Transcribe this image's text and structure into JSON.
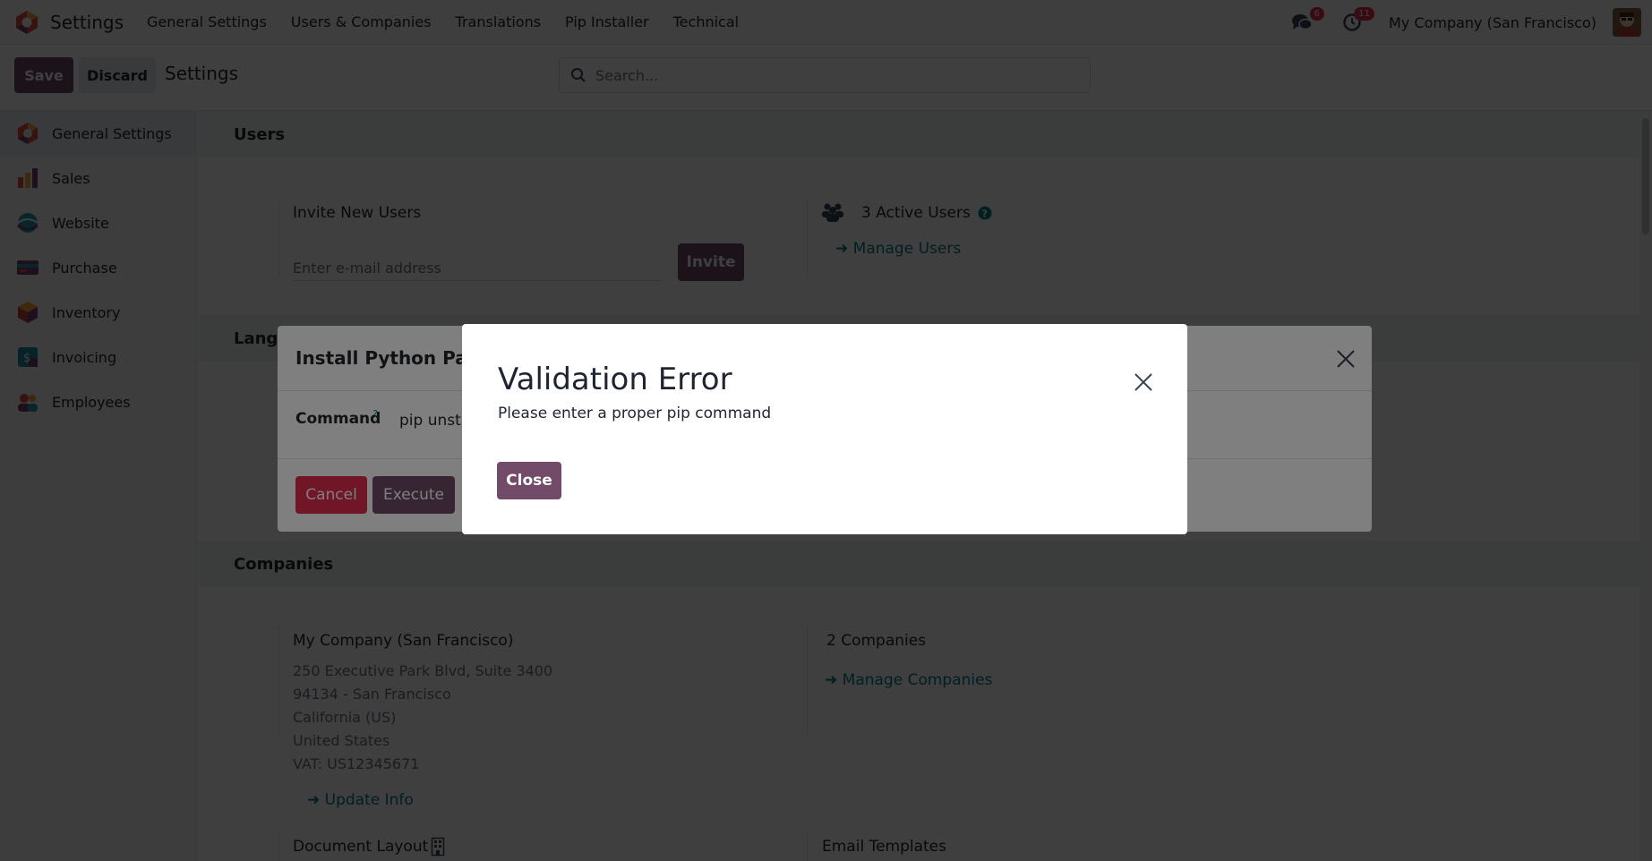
{
  "navbar": {
    "app_title": "Settings",
    "menu": [
      "General Settings",
      "Users & Companies",
      "Translations",
      "Pip Installer",
      "Technical"
    ],
    "messages_badge": "6",
    "activities_badge": "11",
    "company": "My Company (San Francisco)"
  },
  "control_panel": {
    "save_label": "Save",
    "discard_label": "Discard",
    "title": "Settings",
    "search_placeholder": "Search..."
  },
  "sidebar": {
    "items": [
      {
        "label": "General Settings",
        "icon": "settings-app-icon",
        "color": "#e04b38"
      },
      {
        "label": "Sales",
        "icon": "sales-app-icon",
        "color": "#e0803a"
      },
      {
        "label": "Website",
        "icon": "website-app-icon",
        "color": "#1f9aa8"
      },
      {
        "label": "Purchase",
        "icon": "purchase-app-icon",
        "color": "#7b3f74"
      },
      {
        "label": "Inventory",
        "icon": "inventory-app-icon",
        "color": "#c4453a"
      },
      {
        "label": "Invoicing",
        "icon": "invoicing-app-icon",
        "color": "#1d8ea0"
      },
      {
        "label": "Employees",
        "icon": "employees-app-icon",
        "color": "#d9534f"
      }
    ]
  },
  "users": {
    "section_title": "Users",
    "invite_label": "Invite New Users",
    "email_placeholder": "Enter e-mail address",
    "invite_button": "Invite",
    "active_users": "3 Active Users",
    "manage_users": "Manage Users"
  },
  "languages": {
    "section_title": "Langu"
  },
  "companies": {
    "section_title": "Companies",
    "company_name": "My Company (San Francisco)",
    "address_line1": "250 Executive Park Blvd, Suite 3400",
    "address_line2": "94134 - San Francisco",
    "address_line3": "California (US)",
    "address_line4": "United States",
    "vat": "VAT:  US12345671",
    "update_info": "Update Info",
    "count": "2 Companies",
    "manage_companies": "Manage Companies",
    "document_layout": "Document Layout",
    "email_templates": "Email Templates"
  },
  "install_dialog": {
    "title": "Install Python Pack",
    "command_label": "Command",
    "help_mark": "?",
    "command_value": "pip unsta",
    "cancel_button": "Cancel",
    "execute_button": "Execute"
  },
  "error_dialog": {
    "title": "Validation Error",
    "message": "Please enter a proper pip command",
    "close_button": "Close"
  }
}
